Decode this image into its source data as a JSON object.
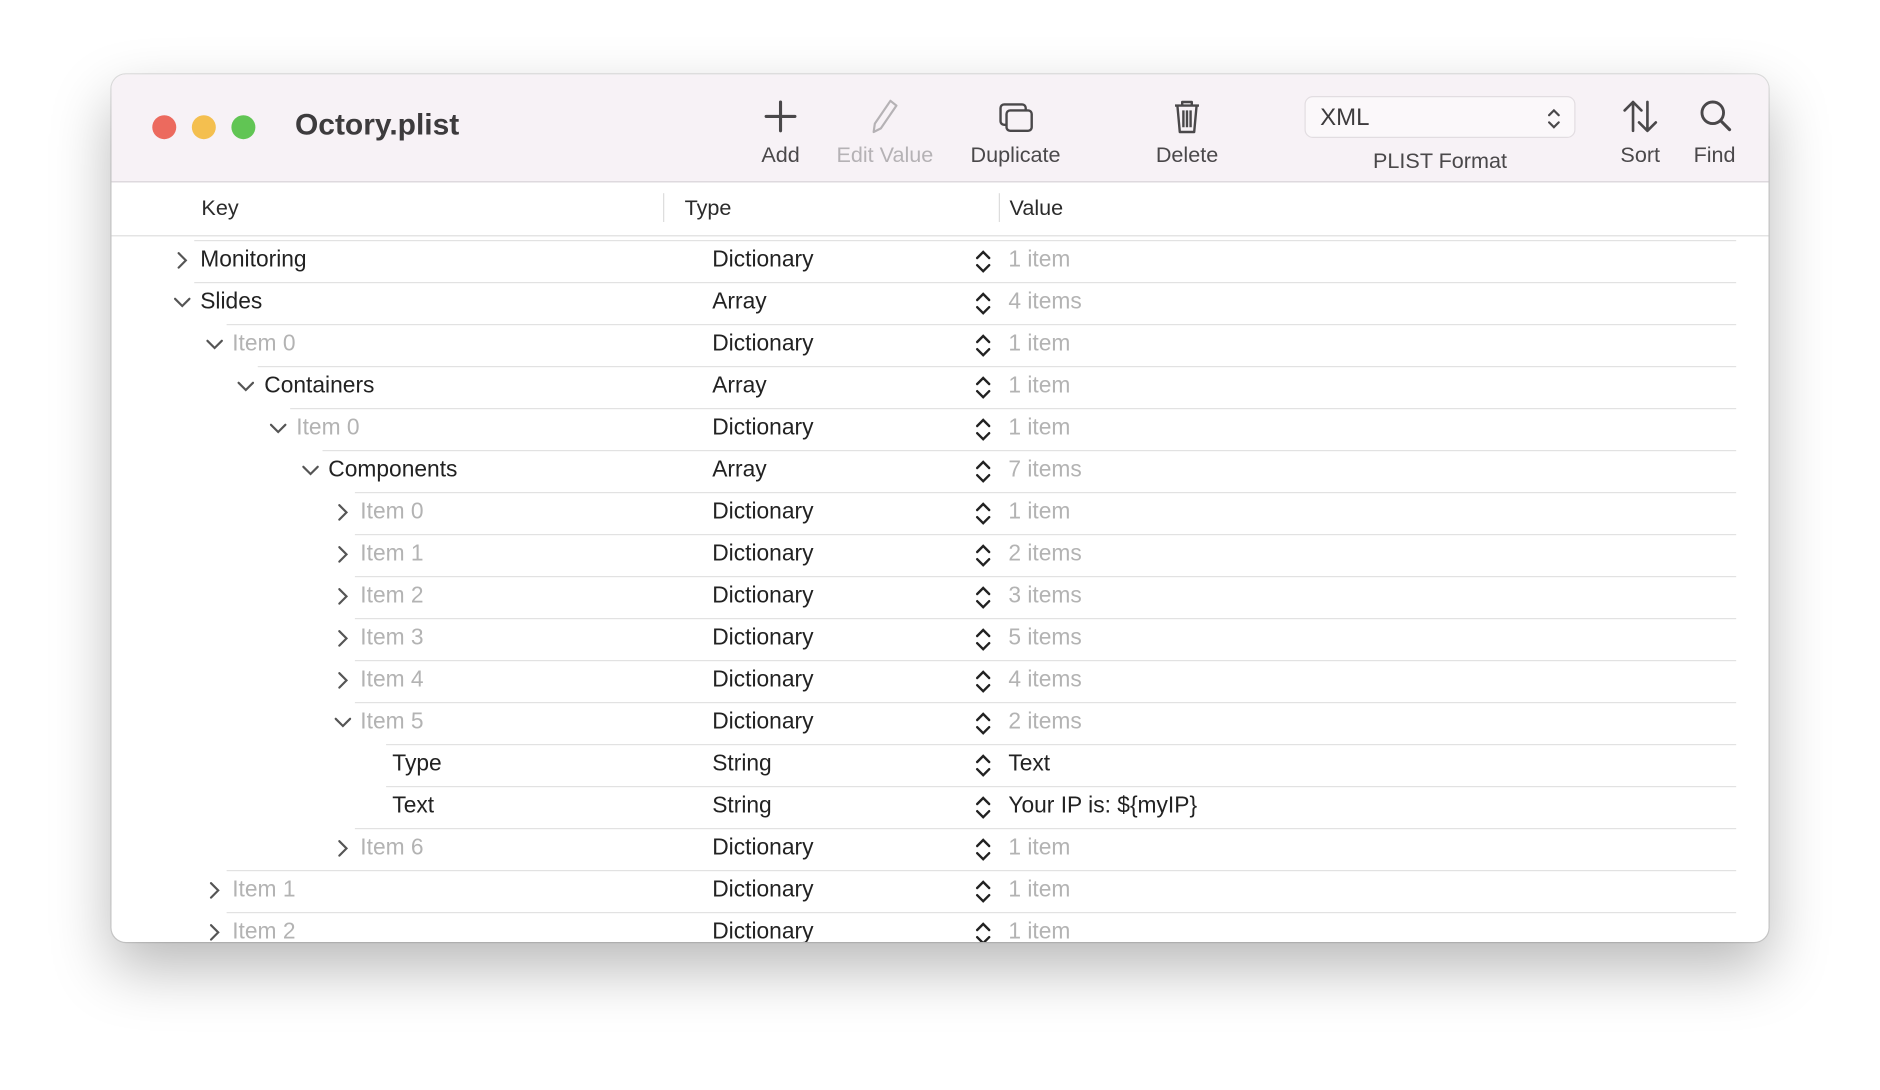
{
  "window": {
    "title": "Octory.plist"
  },
  "traffic_lights": {
    "close": "#ec6a5e",
    "minimize": "#f4bf4f",
    "zoom": "#61c554"
  },
  "toolbar": {
    "add": "Add",
    "edit_value": "Edit Value",
    "duplicate": "Duplicate",
    "delete": "Delete",
    "format_value": "XML",
    "format_label": "PLIST Format",
    "sort": "Sort",
    "find": "Find"
  },
  "columns": {
    "key": "Key",
    "type": "Type",
    "value": "Value"
  },
  "rows": [
    {
      "key": "Monitoring",
      "type": "Dictionary",
      "value": "1 item",
      "depth": 0,
      "state": "collapsed",
      "key_gray": false,
      "value_gray": true
    },
    {
      "key": "Slides",
      "type": "Array",
      "value": "4 items",
      "depth": 0,
      "state": "expanded",
      "key_gray": false,
      "value_gray": true
    },
    {
      "key": "Item 0",
      "type": "Dictionary",
      "value": "1 item",
      "depth": 1,
      "state": "expanded",
      "key_gray": true,
      "value_gray": true
    },
    {
      "key": "Containers",
      "type": "Array",
      "value": "1 item",
      "depth": 2,
      "state": "expanded",
      "key_gray": false,
      "value_gray": true
    },
    {
      "key": "Item 0",
      "type": "Dictionary",
      "value": "1 item",
      "depth": 3,
      "state": "expanded",
      "key_gray": true,
      "value_gray": true
    },
    {
      "key": "Components",
      "type": "Array",
      "value": "7 items",
      "depth": 4,
      "state": "expanded",
      "key_gray": false,
      "value_gray": true
    },
    {
      "key": "Item 0",
      "type": "Dictionary",
      "value": "1 item",
      "depth": 5,
      "state": "collapsed",
      "key_gray": true,
      "value_gray": true
    },
    {
      "key": "Item 1",
      "type": "Dictionary",
      "value": "2 items",
      "depth": 5,
      "state": "collapsed",
      "key_gray": true,
      "value_gray": true
    },
    {
      "key": "Item 2",
      "type": "Dictionary",
      "value": "3 items",
      "depth": 5,
      "state": "collapsed",
      "key_gray": true,
      "value_gray": true
    },
    {
      "key": "Item 3",
      "type": "Dictionary",
      "value": "5 items",
      "depth": 5,
      "state": "collapsed",
      "key_gray": true,
      "value_gray": true
    },
    {
      "key": "Item 4",
      "type": "Dictionary",
      "value": "4 items",
      "depth": 5,
      "state": "collapsed",
      "key_gray": true,
      "value_gray": true
    },
    {
      "key": "Item 5",
      "type": "Dictionary",
      "value": "2 items",
      "depth": 5,
      "state": "expanded",
      "key_gray": true,
      "value_gray": true
    },
    {
      "key": "Type",
      "type": "String",
      "value": "Text",
      "depth": 6,
      "state": "leaf",
      "key_gray": false,
      "value_gray": false
    },
    {
      "key": "Text",
      "type": "String",
      "value": "Your IP is: ${myIP}",
      "depth": 6,
      "state": "leaf",
      "key_gray": false,
      "value_gray": false
    },
    {
      "key": "Item 6",
      "type": "Dictionary",
      "value": "1 item",
      "depth": 5,
      "state": "collapsed",
      "key_gray": true,
      "value_gray": true
    },
    {
      "key": "Item 1",
      "type": "Dictionary",
      "value": "1 item",
      "depth": 1,
      "state": "collapsed",
      "key_gray": true,
      "value_gray": true
    },
    {
      "key": "Item 2",
      "type": "Dictionary",
      "value": "1 item",
      "depth": 1,
      "state": "collapsed",
      "key_gray": true,
      "value_gray": true
    }
  ]
}
